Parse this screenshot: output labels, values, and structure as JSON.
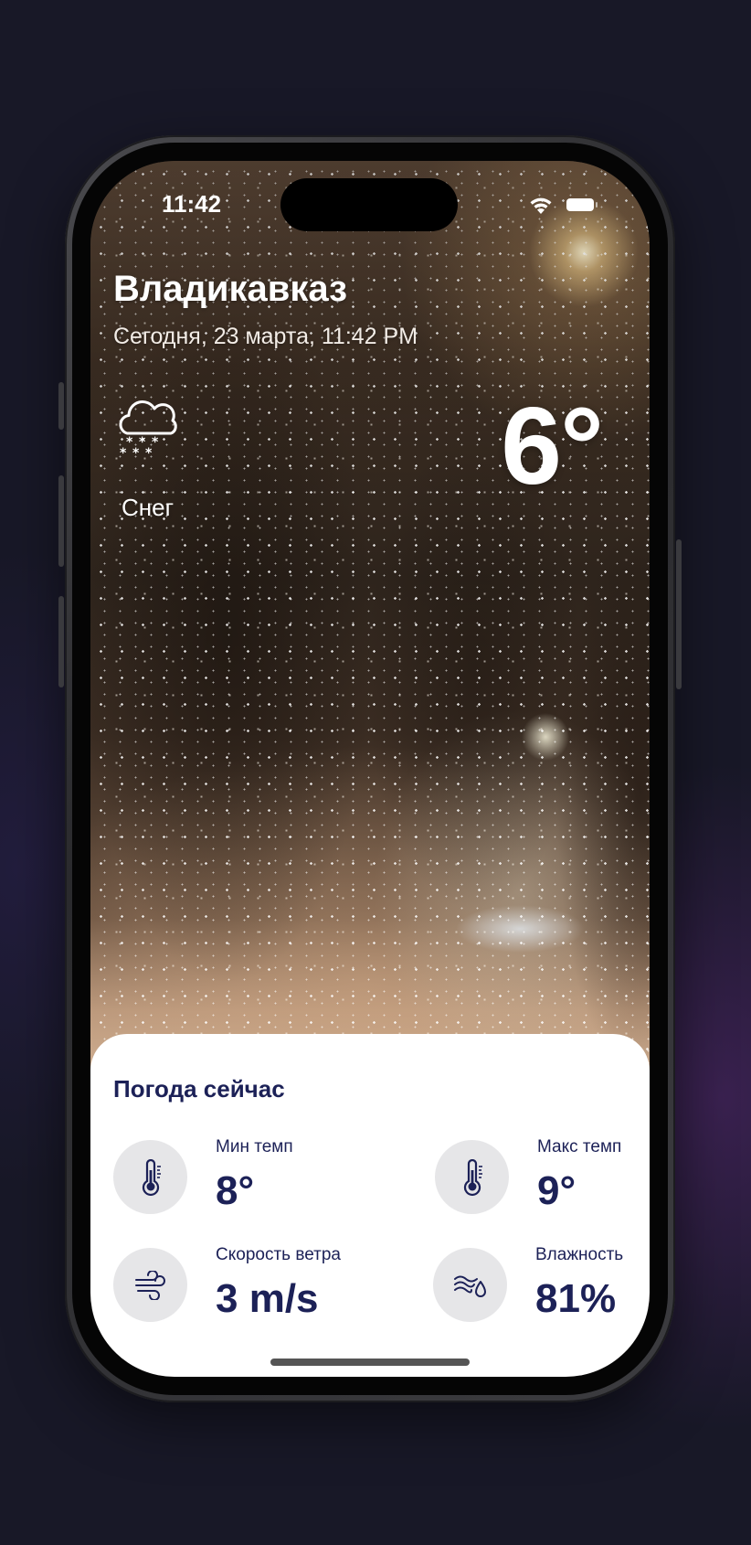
{
  "status_bar": {
    "time": "11:42",
    "wifi_icon": "wifi-icon",
    "battery_icon": "battery-icon"
  },
  "header": {
    "city": "Владикавказ",
    "date": "Сегодня, 23 марта, 11:42 PM"
  },
  "current": {
    "icon": "snow-cloud-icon",
    "condition": "Снег",
    "temperature": "6°"
  },
  "panel": {
    "title": "Погода сейчас",
    "metrics": [
      {
        "label": "Мин темп",
        "value": "8°",
        "icon": "thermometer-icon"
      },
      {
        "label": "Макс темп",
        "value": "9°",
        "icon": "thermometer-icon"
      },
      {
        "label": "Скорость ветра",
        "value": "3 m/s",
        "icon": "wind-icon"
      },
      {
        "label": "Влажность",
        "value": "81%",
        "icon": "humidity-icon"
      }
    ]
  },
  "colors": {
    "accent_text": "#1c2157",
    "icon_circle": "#e6e6e8",
    "background": "#181827"
  }
}
